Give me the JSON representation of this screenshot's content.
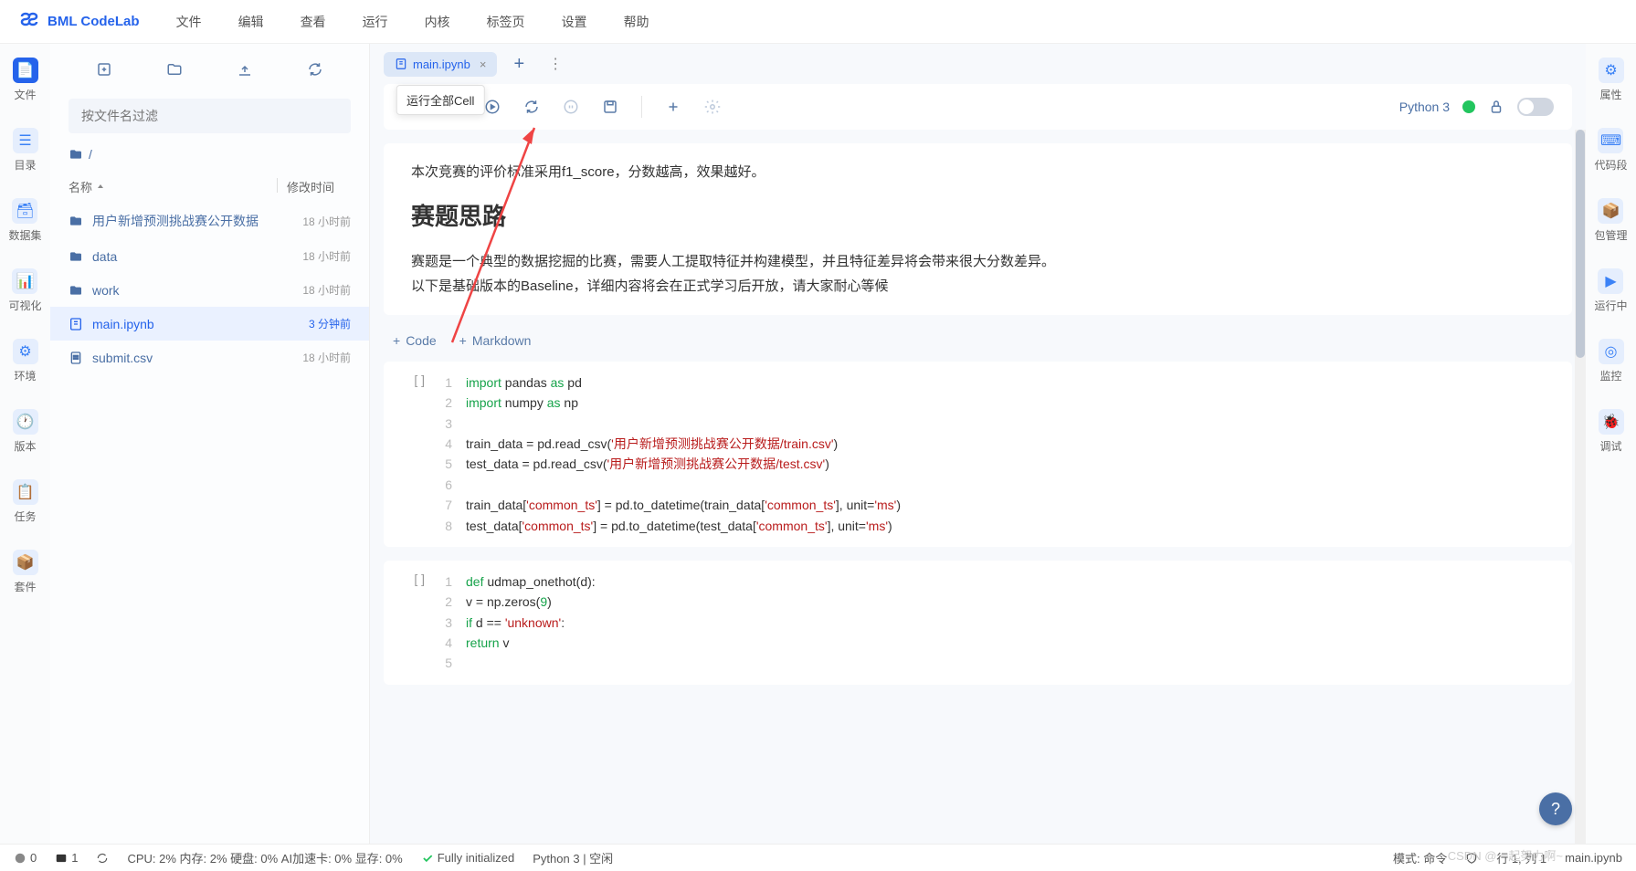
{
  "app": {
    "name": "BML CodeLab"
  },
  "menu": [
    "文件",
    "编辑",
    "查看",
    "运行",
    "内核",
    "标签页",
    "设置",
    "帮助"
  ],
  "leftRail": [
    {
      "label": "文件",
      "active": true
    },
    {
      "label": "目录"
    },
    {
      "label": "数据集"
    },
    {
      "label": "可视化"
    },
    {
      "label": "环境"
    },
    {
      "label": "版本"
    },
    {
      "label": "任务"
    },
    {
      "label": "套件"
    }
  ],
  "filePanel": {
    "filterPlaceholder": "按文件名过滤",
    "breadcrumb": "/",
    "colName": "名称",
    "colTime": "修改时间",
    "files": [
      {
        "name": "用户新增预测挑战赛公开数据",
        "time": "18 小时前",
        "type": "folder"
      },
      {
        "name": "data",
        "time": "18 小时前",
        "type": "folder"
      },
      {
        "name": "work",
        "time": "18 小时前",
        "type": "folder"
      },
      {
        "name": "main.ipynb",
        "time": "3 分钟前",
        "type": "ipynb",
        "selected": true
      },
      {
        "name": "submit.csv",
        "time": "18 小时前",
        "type": "file"
      }
    ]
  },
  "tabs": {
    "active": "main.ipynb",
    "tooltip": "运行全部Cell",
    "addLabel": "+"
  },
  "toolbar": {
    "kernel": "Python 3"
  },
  "markdown": {
    "p1": "本次竞赛的评价标准采用f1_score，分数越高，效果越好。",
    "h2": "赛题思路",
    "p2": "赛题是一个典型的数据挖掘的比赛，需要人工提取特征并构建模型，并且特征差异将会带来很大分数差异。",
    "p3": "以下是基础版本的Baseline，详细内容将会在正式学习后开放，请大家耐心等候"
  },
  "addCell": {
    "code": "Code",
    "md": "Markdown"
  },
  "cell1": {
    "lines": [
      {
        "n": "1",
        "h": "<span class='kw'>import</span> pandas <span class='kw'>as</span> pd"
      },
      {
        "n": "2",
        "h": "<span class='kw'>import</span> numpy <span class='kw'>as</span> np"
      },
      {
        "n": "3",
        "h": ""
      },
      {
        "n": "4",
        "h": "train_data = pd.read_csv(<span class='str'>'用户新增预测挑战赛公开数据/train.csv'</span>)"
      },
      {
        "n": "5",
        "h": "test_data = pd.read_csv(<span class='str'>'用户新增预测挑战赛公开数据/test.csv'</span>)"
      },
      {
        "n": "6",
        "h": ""
      },
      {
        "n": "7",
        "h": "train_data[<span class='str'>'common_ts'</span>] = pd.to_datetime(train_data[<span class='str'>'common_ts'</span>], unit=<span class='str'>'ms'</span>)"
      },
      {
        "n": "8",
        "h": "test_data[<span class='str'>'common_ts'</span>] = pd.to_datetime(test_data[<span class='str'>'common_ts'</span>], unit=<span class='str'>'ms'</span>)"
      }
    ]
  },
  "cell2": {
    "lines": [
      {
        "n": "1",
        "h": "<span class='kw'>def</span> udmap_onethot(d):"
      },
      {
        "n": "2",
        "h": "    v = np.zeros(<span class='num'>9</span>)"
      },
      {
        "n": "3",
        "h": "    <span class='kw'>if</span> d == <span class='str'>'unknown'</span>:"
      },
      {
        "n": "4",
        "h": "        <span class='kw'>return</span> v"
      },
      {
        "n": "5",
        "h": ""
      }
    ]
  },
  "rightRail": [
    "属性",
    "代码段",
    "包管理",
    "运行中",
    "监控",
    "调试"
  ],
  "status": {
    "left0": "0",
    "left1": "1",
    "resources": "CPU: 2% 内存: 2% 硬盘: 0% AI加速卡: 0% 显存: 0%",
    "init": "Fully initialized",
    "kernel": "Python 3 | 空闲",
    "mode": "模式: 命令",
    "cursor": "行 1, 列 1",
    "filename": "main.ipynb"
  },
  "watermark": "CSDN @一起努力啊~"
}
